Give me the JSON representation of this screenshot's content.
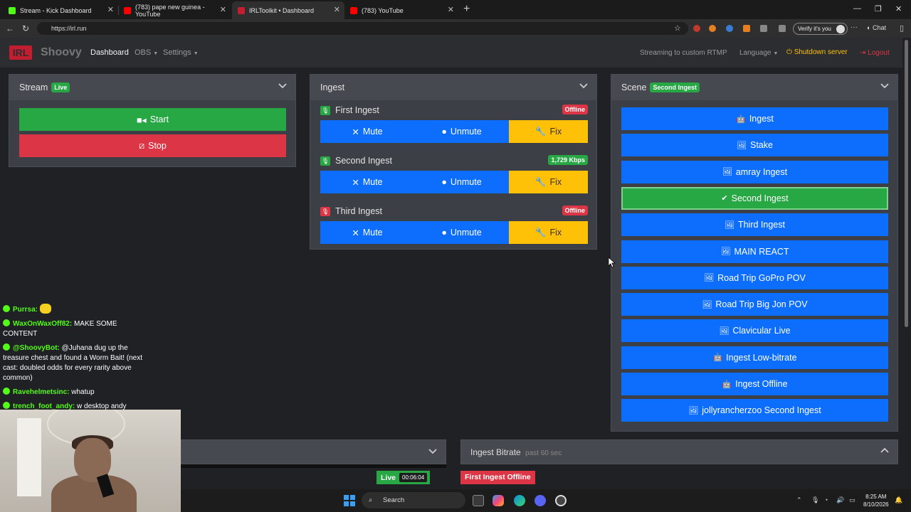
{
  "browser": {
    "tabs": [
      {
        "title": "Stream - Kick Dashboard",
        "color": "#53fc18"
      },
      {
        "title": "(783) pape new guinea - YouTube",
        "color": "#ff0000"
      },
      {
        "title": "IRLToolkit • Dashboard",
        "color": "#c31e2f"
      },
      {
        "title": "(783) YouTube",
        "color": "#ff0000"
      }
    ],
    "url": "https://irl.run",
    "verify": "Verify it's you",
    "chat": "Chat"
  },
  "navbar": {
    "logo": "IRL",
    "brand": "Shoovy",
    "dashboard": "Dashboard",
    "obs": "OBS",
    "settings": "Settings",
    "streaming_to": "Streaming to custom RTMP",
    "language": "Language",
    "shutdown": "Shutdown server",
    "logout": "Logout"
  },
  "stream_panel": {
    "title": "Stream",
    "badge": "Live",
    "start": "Start",
    "stop": "Stop"
  },
  "ingest_panel": {
    "title": "Ingest",
    "ingests": [
      {
        "name": "First Ingest",
        "status": "Offline",
        "status_color": "#dc3545",
        "icon_color": "#28a745"
      },
      {
        "name": "Second Ingest",
        "status": "1,729 Kbps",
        "status_color": "#28a745",
        "icon_color": "#28a745"
      },
      {
        "name": "Third Ingest",
        "status": "Offline",
        "status_color": "#dc3545",
        "icon_color": "#dc3545"
      }
    ],
    "mute": "Mute",
    "unmute": "Unmute",
    "fix": "Fix"
  },
  "scene_panel": {
    "title": "Scene",
    "badge": "Second Ingest",
    "scenes": [
      {
        "label": "Ingest",
        "icon": "robot-icon"
      },
      {
        "label": "Stake",
        "icon": "image-icon"
      },
      {
        "label": "amray Ingest",
        "icon": "image-icon"
      },
      {
        "label": "Second Ingest",
        "icon": "check-icon",
        "selected": true
      },
      {
        "label": "Third Ingest",
        "icon": "image-icon"
      },
      {
        "label": "MAIN REACT",
        "icon": "image-icon"
      },
      {
        "label": "Road Trip GoPro POV",
        "icon": "image-icon"
      },
      {
        "label": "Road Trip Big Jon POV",
        "icon": "image-icon"
      },
      {
        "label": "Clavicular Live",
        "icon": "image-icon"
      },
      {
        "label": "Ingest Low-bitrate",
        "icon": "robot-icon"
      },
      {
        "label": "Ingest Offline",
        "icon": "robot-icon"
      },
      {
        "label": "jollyrancherzoo Second Ingest",
        "icon": "image-icon"
      }
    ]
  },
  "bitrate_panel": {
    "title": "Ingest Bitrate",
    "subtitle": "past 60 sec"
  },
  "status_bar": {
    "live": "Live",
    "time": "00:06:04",
    "offline": "First Ingest Offline"
  },
  "chat": [
    {
      "user": "Purrsa:",
      "text": ""
    },
    {
      "user": "WaxOnWaxOff82:",
      "text": "MAKE SOME CONTENT"
    },
    {
      "user": "@ShoovyBot:",
      "text": "@Juhana dug up the treasure chest and found a  Worm Bait! (next cast: doubled odds for every rarity above common)"
    },
    {
      "user": "Ravehelmetsinc:",
      "text": "whatup"
    },
    {
      "user": "trench_foot_andy:",
      "text": "w desktop andy"
    }
  ],
  "taskbar": {
    "search": "Search",
    "time": "8:25 AM",
    "date": "8/10/2026"
  }
}
